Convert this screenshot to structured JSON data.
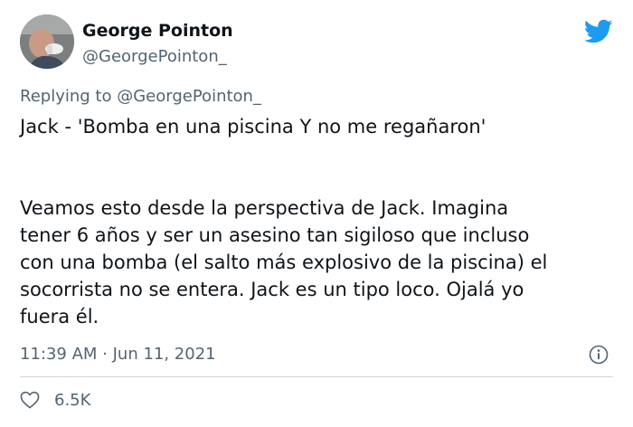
{
  "tweet": {
    "author_name": "George Pointon",
    "author_handle": "@GeorgePointon_",
    "replying_prefix": "Replying to",
    "replying_handle": "@GeorgePointon_",
    "line1": "Jack - 'Bomba en una piscina Y no me regañaron'",
    "body_lines": [
      "Veamos esto desde la perspectiva de Jack. Imagina",
      "tener 6 años y ser un asesino tan sigiloso que incluso",
      "con una bomba (el salto más explosivo de la piscina) el",
      "socorrista no se entera. Jack es un tipo loco. Ojalá yo",
      "fuera él."
    ],
    "timestamp": "11:39 AM · Jun 11, 2021",
    "likes": "6.5K"
  },
  "icons": {
    "brand": "twitter-bird-icon",
    "info": "info-icon",
    "like": "heart-icon"
  },
  "colors": {
    "brand_blue": "#1d9bf0",
    "text": "#0f1419",
    "muted": "#536471"
  }
}
